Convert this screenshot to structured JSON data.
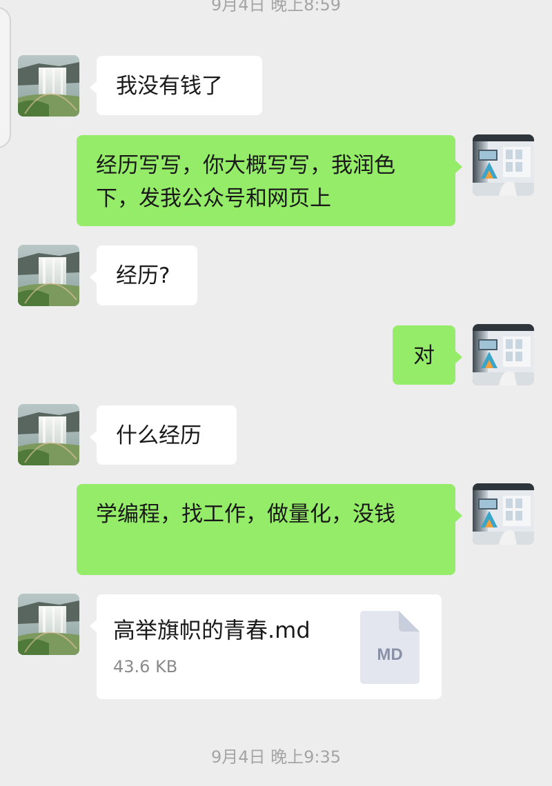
{
  "timestamps": {
    "top": "9月4日 晚上8:59",
    "bottom": "9月4日 晚上9:35"
  },
  "messages": [
    {
      "side": "left",
      "text": "我没有钱了"
    },
    {
      "side": "right",
      "text": "经历写写，你大概写写，我润色下，发我公众号和网页上"
    },
    {
      "side": "left",
      "text": "经历?"
    },
    {
      "side": "right",
      "text": "对"
    },
    {
      "side": "left",
      "text": "什么经历"
    },
    {
      "side": "right",
      "text": "学编程，找工作，做量化，没钱"
    }
  ],
  "file": {
    "name": "高举旗帜的青春.md",
    "size": "43.6 KB",
    "ext": "MD"
  },
  "colors": {
    "background": "#ededed",
    "bubble_self": "#95ec69",
    "bubble_other": "#ffffff"
  },
  "avatars": {
    "left": "waterfall-avatar",
    "right": "office-avatar"
  }
}
